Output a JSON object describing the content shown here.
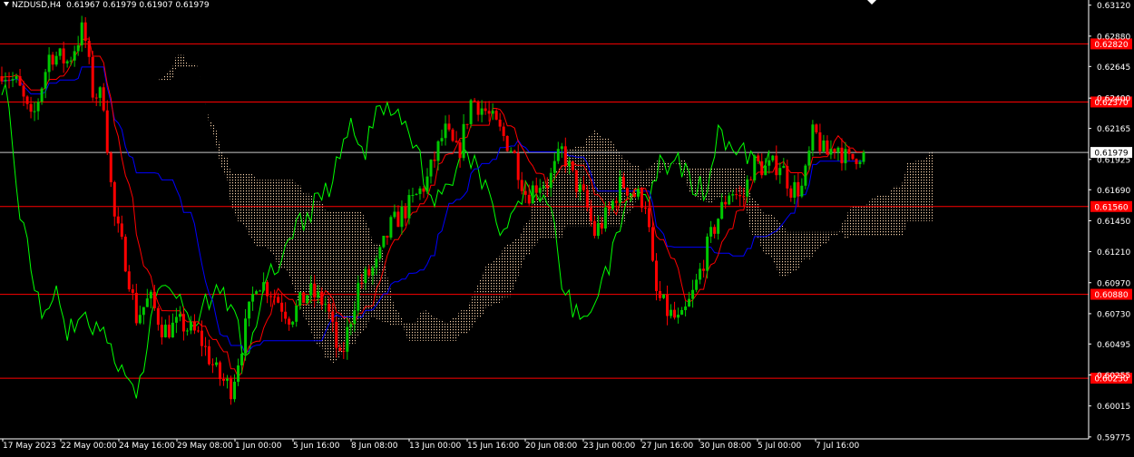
{
  "header": {
    "symbol": "NZDUSD,H4",
    "open": "0.61967",
    "high": "0.61979",
    "low": "0.61907",
    "close": "0.61979"
  },
  "colors": {
    "background": "#000000",
    "bull_candle": "#00c800",
    "bear_candle": "#ff0000",
    "tenkan_sen": "#ff0000",
    "kijun_sen": "#0000ff",
    "chikou_span": "#00ff00",
    "cloud": "#ffd8b0",
    "level_line": "#ff0000",
    "level_label": "#ff0000",
    "current_price_line": "#c8c8c8",
    "axis_text": "#ffffff",
    "frame": "#ffffff"
  },
  "chart_data": {
    "type": "candlestick",
    "symbol": "NZDUSD",
    "timeframe": "H4",
    "y_range": [
      0.5976,
      0.6316
    ],
    "y_ticks": [
      "0.63120",
      "0.62880",
      "0.62645",
      "0.62400",
      "0.62165",
      "0.61925",
      "0.61690",
      "0.61450",
      "0.61210",
      "0.60970",
      "0.60730",
      "0.60495",
      "0.60255",
      "0.60015",
      "0.59775"
    ],
    "x_labels": [
      "17 May 2023",
      "22 May 00:00",
      "24 May 16:00",
      "29 May 08:00",
      "1 Jun 00:00",
      "5 Jun 16:00",
      "8 Jun 08:00",
      "13 Jun 00:00",
      "15 Jun 16:00",
      "20 Jun 08:00",
      "23 Jun 00:00",
      "27 Jun 16:00",
      "30 Jun 08:00",
      "5 Jul 00:00",
      "7 Jul 16:00"
    ],
    "levels": [
      {
        "value": 0.6282,
        "label": "0.62820"
      },
      {
        "value": 0.6237,
        "label": "0.62370"
      },
      {
        "value": 0.6156,
        "label": "0.61560"
      },
      {
        "value": 0.6088,
        "label": "0.60880"
      },
      {
        "value": 0.6023,
        "label": "0.60230"
      }
    ],
    "current_price": {
      "value": 0.61979,
      "label": "0.61979"
    },
    "ichimoku": true
  }
}
